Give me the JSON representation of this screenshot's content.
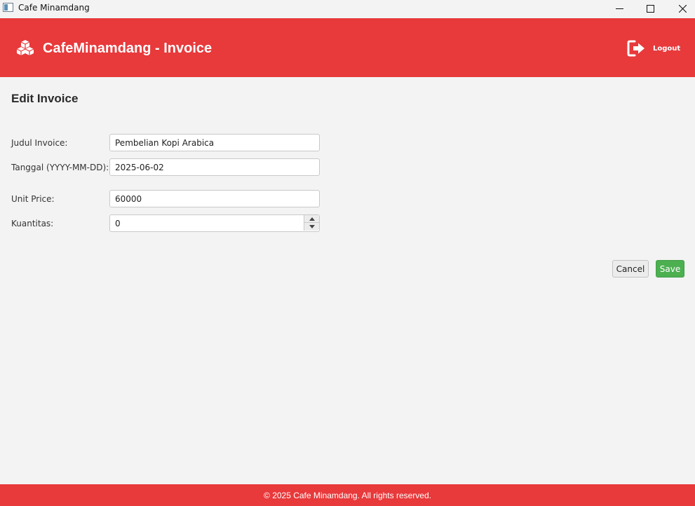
{
  "window": {
    "title": "Cafe Minamdang"
  },
  "header": {
    "title": "CafeMinamdang - Invoice",
    "logout_label": "Logout",
    "brand_icon": "cubes-icon",
    "logout_icon": "sign-out-icon"
  },
  "page": {
    "title": "Edit Invoice"
  },
  "form": {
    "judul_label": "Judul Invoice:",
    "judul_value": "Pembelian Kopi Arabica",
    "tanggal_label": "Tanggal (YYYY-MM-DD):",
    "tanggal_value": "2025-06-02",
    "unit_price_label": "Unit Price:",
    "unit_price_value": "60000",
    "kuantitas_label": "Kuantitas:",
    "kuantitas_value": "0"
  },
  "actions": {
    "cancel_label": "Cancel",
    "save_label": "Save"
  },
  "footer": {
    "text": "© 2025 Cafe Minamdang. All rights reserved."
  },
  "colors": {
    "brand": "#e8393b",
    "save": "#4caf50",
    "background": "#f3f3f3"
  }
}
